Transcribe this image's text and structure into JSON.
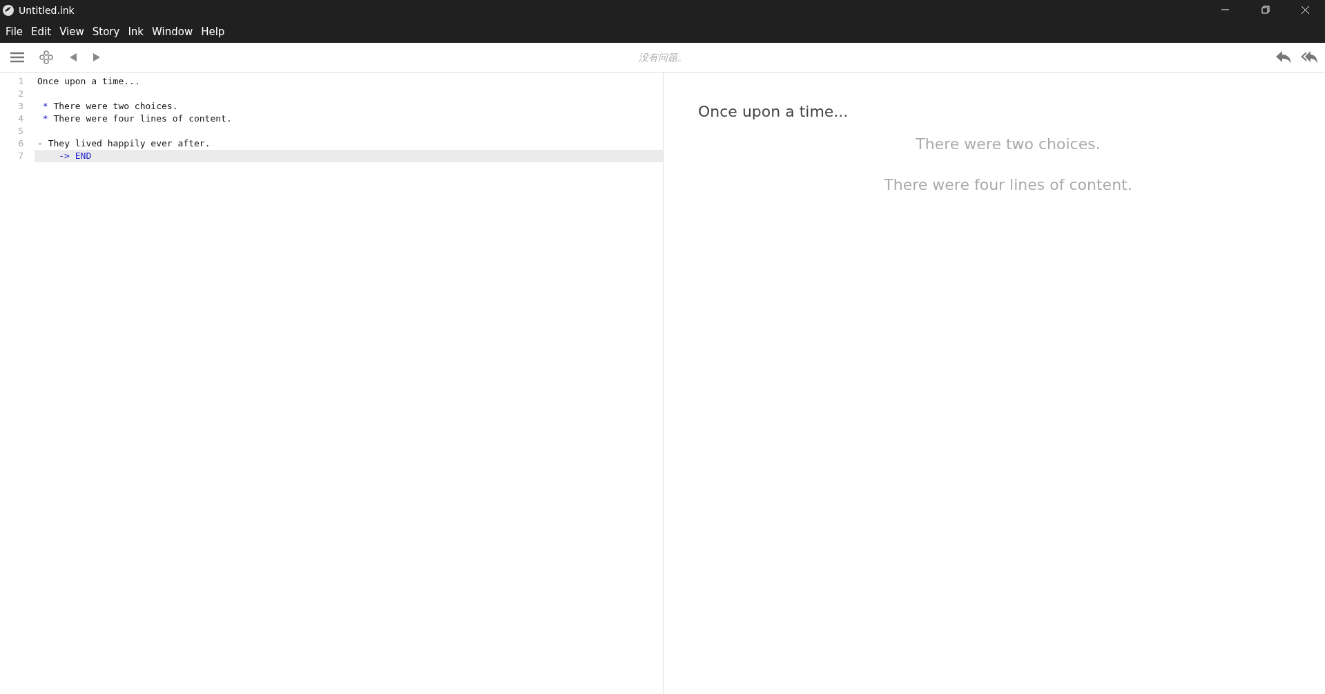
{
  "window": {
    "title": "Untitled.ink"
  },
  "menu": [
    "File",
    "Edit",
    "View",
    "Story",
    "Ink",
    "Window",
    "Help"
  ],
  "toolbar": {
    "status": "没有问题。"
  },
  "editor": {
    "lines": [
      {
        "number": "1",
        "current": false,
        "kind": "plain",
        "segments": [
          {
            "kind": "text",
            "text": "Once upon a time..."
          }
        ]
      },
      {
        "number": "2",
        "current": false,
        "kind": "plain"
      },
      {
        "number": "3",
        "current": false,
        "kind": "choice",
        "segments": [
          {
            "kind": "symbol",
            "text": "*"
          },
          {
            "kind": "text",
            "text": " There were two choices."
          }
        ]
      },
      {
        "number": "4",
        "current": false,
        "kind": "choice",
        "segments": [
          {
            "kind": "symbol",
            "text": "*"
          },
          {
            "kind": "text",
            "text": " There were four lines of content."
          }
        ]
      },
      {
        "number": "5",
        "current": false,
        "kind": "plain"
      },
      {
        "number": "6",
        "current": false,
        "kind": "plain",
        "segments": [
          {
            "kind": "text",
            "text": "- They lived happily ever after."
          }
        ]
      },
      {
        "number": "7",
        "current": true,
        "kind": "divert",
        "segments": [
          {
            "kind": "symbol",
            "text": "-> END"
          }
        ]
      }
    ]
  },
  "preview": {
    "paragraphs": [
      {
        "kind": "text",
        "text": "Once upon a time..."
      },
      {
        "kind": "choice",
        "text": "There were two choices."
      },
      {
        "kind": "choice",
        "text": "There were four lines of content."
      }
    ]
  }
}
